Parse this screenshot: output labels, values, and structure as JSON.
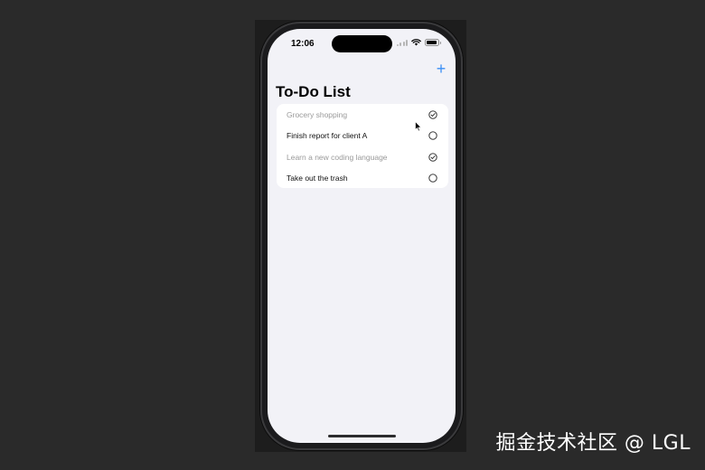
{
  "status_bar": {
    "time": "12:06"
  },
  "nav": {
    "add_label": "+"
  },
  "page": {
    "title": "To-Do List"
  },
  "todos": [
    {
      "text": "Grocery shopping",
      "completed": true
    },
    {
      "text": "Finish report for client A",
      "completed": false
    },
    {
      "text": "Learn a new coding language",
      "completed": true
    },
    {
      "text": "Take out the trash",
      "completed": false
    }
  ],
  "watermark": {
    "text": "掘金技术社区 @ LGL"
  },
  "colors": {
    "accent": "#3b8ff5",
    "completed_text": "#9a9a9a",
    "background": "#f2f2f7"
  },
  "icons": {
    "completed": "checkmark-circle-icon",
    "pending": "empty-circle-icon",
    "add": "plus-icon"
  }
}
